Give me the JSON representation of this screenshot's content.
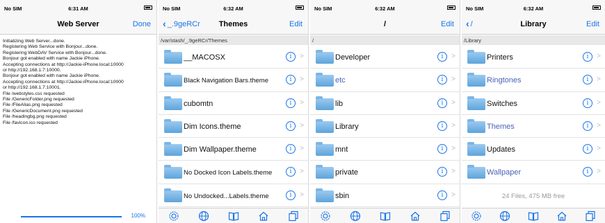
{
  "colors": {
    "accent": "#1a73e8",
    "folder": "#5ea4db",
    "link_text": "#4a62b8"
  },
  "screens": [
    {
      "status": {
        "carrier": "No SIM",
        "time": "6:31 AM"
      },
      "nav": {
        "title": "Web Server",
        "right_label": "Done"
      },
      "log_lines": [
        "Initializing Web Server...done.",
        "Registering Web Service with Bonjour...done.",
        "Registering WebDAV Service with Bonjour...done.",
        "Bonjour got enabled with name Jackie iPhone.",
        "Accepting connections at http://Jackie-iPhone.local:10000",
        "or http://192.168.1.7:10000.",
        "Bonjour got enabled with name Jackie iPhone.",
        "Accepting connections at http://Jackie-iPhone.local:10000",
        "or http://192.168.1.7:10001.",
        "File /webstyles.css requested",
        "File /GenericFolder.png requested",
        "File /FileAlias.png requested",
        "File /GenericDocument.png requested",
        "File /headingbg.png requested",
        "File /favicon.ico requested"
      ],
      "progress": {
        "percent": 100,
        "label": "100%"
      }
    },
    {
      "status": {
        "carrier": "No SIM",
        "time": "6:32 AM"
      },
      "nav": {
        "title": "Themes",
        "back_label": "_.9geRCr",
        "right_label": "Edit"
      },
      "path": "/var/stash/_.9geRCr/Themes",
      "rows": [
        {
          "label": "__MACOSX",
          "style": ""
        },
        {
          "label": "Black Navigation Bars.theme",
          "style": "small"
        },
        {
          "label": "cubomtn",
          "style": ""
        },
        {
          "label": "Dim Icons.theme",
          "style": ""
        },
        {
          "label": "Dim Wallpaper.theme",
          "style": ""
        },
        {
          "label": "No Docked Icon Labels.theme",
          "style": "small"
        },
        {
          "label": "No Undocked...Labels.theme",
          "style": "small"
        }
      ]
    },
    {
      "status": {
        "carrier": "No SIM",
        "time": "6:32 AM"
      },
      "nav": {
        "title": "/",
        "right_label": "Edit"
      },
      "path": "/",
      "rows": [
        {
          "label": "Developer",
          "style": ""
        },
        {
          "label": "etc",
          "style": "link"
        },
        {
          "label": "lib",
          "style": ""
        },
        {
          "label": "Library",
          "style": ""
        },
        {
          "label": "mnt",
          "style": ""
        },
        {
          "label": "private",
          "style": ""
        },
        {
          "label": "sbin",
          "style": ""
        }
      ]
    },
    {
      "status": {
        "carrier": "No SIM",
        "time": "6:32 AM"
      },
      "nav": {
        "title": "Library",
        "back_label": "/",
        "right_label": "Edit"
      },
      "path": "/Library",
      "rows": [
        {
          "label": "Printers",
          "style": ""
        },
        {
          "label": "Ringtones",
          "style": "link"
        },
        {
          "label": "Switches",
          "style": ""
        },
        {
          "label": "Themes",
          "style": "link"
        },
        {
          "label": "Updates",
          "style": ""
        },
        {
          "label": "Wallpaper",
          "style": "link"
        }
      ],
      "footer": "24 Files, 475 MB free"
    }
  ],
  "tabbar_icons": [
    "gear-icon",
    "globe-icon",
    "book-icon",
    "home-icon",
    "windows-icon"
  ]
}
